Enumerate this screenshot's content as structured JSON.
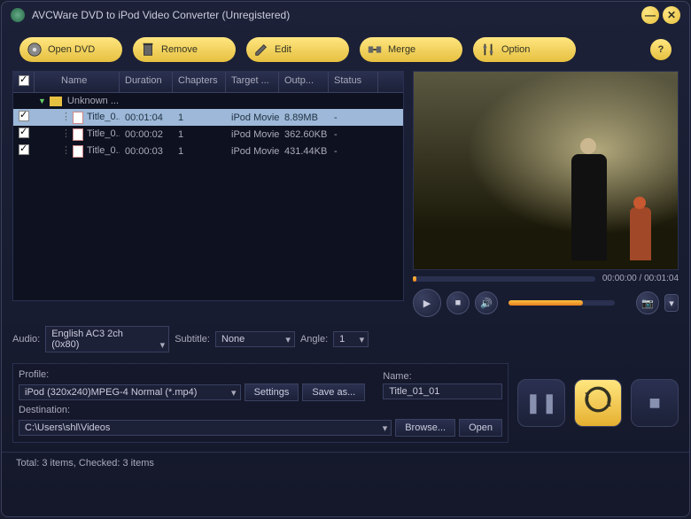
{
  "window": {
    "title": "AVCWare DVD to iPod Video Converter (Unregistered)"
  },
  "toolbar": {
    "open_dvd": "Open DVD",
    "remove": "Remove",
    "edit": "Edit",
    "merge": "Merge",
    "option": "Option"
  },
  "columns": {
    "name": "Name",
    "duration": "Duration",
    "chapters": "Chapters",
    "target": "Target ...",
    "output": "Outp...",
    "status": "Status"
  },
  "group": {
    "label": "Unknown ..."
  },
  "rows": [
    {
      "checked": true,
      "selected": true,
      "name": "Title_0...",
      "duration": "00:01:04",
      "chapters": "1",
      "target": "iPod Movie",
      "output": "8.89MB",
      "status": "-"
    },
    {
      "checked": true,
      "selected": false,
      "name": "Title_0...",
      "duration": "00:00:02",
      "chapters": "1",
      "target": "iPod Movie",
      "output": "362.60KB",
      "status": "-"
    },
    {
      "checked": true,
      "selected": false,
      "name": "Title_0...",
      "duration": "00:00:03",
      "chapters": "1",
      "target": "iPod Movie",
      "output": "431.44KB",
      "status": "-"
    }
  ],
  "preview": {
    "time": "00:00:00 / 00:01:04"
  },
  "audiobar": {
    "audio_label": "Audio:",
    "audio_value": "English AC3 2ch (0x80)",
    "subtitle_label": "Subtitle:",
    "subtitle_value": "None",
    "angle_label": "Angle:",
    "angle_value": "1"
  },
  "profile": {
    "profile_label": "Profile:",
    "profile_value": "iPod (320x240)MPEG-4 Normal  (*.mp4)",
    "settings_btn": "Settings",
    "saveas_btn": "Save as...",
    "name_label": "Name:",
    "name_value": "Title_01_01",
    "dest_label": "Destination:",
    "dest_value": "C:\\Users\\shl\\Videos",
    "browse_btn": "Browse...",
    "open_btn": "Open"
  },
  "statusbar": {
    "text": "Total: 3 items, Checked: 3 items"
  }
}
